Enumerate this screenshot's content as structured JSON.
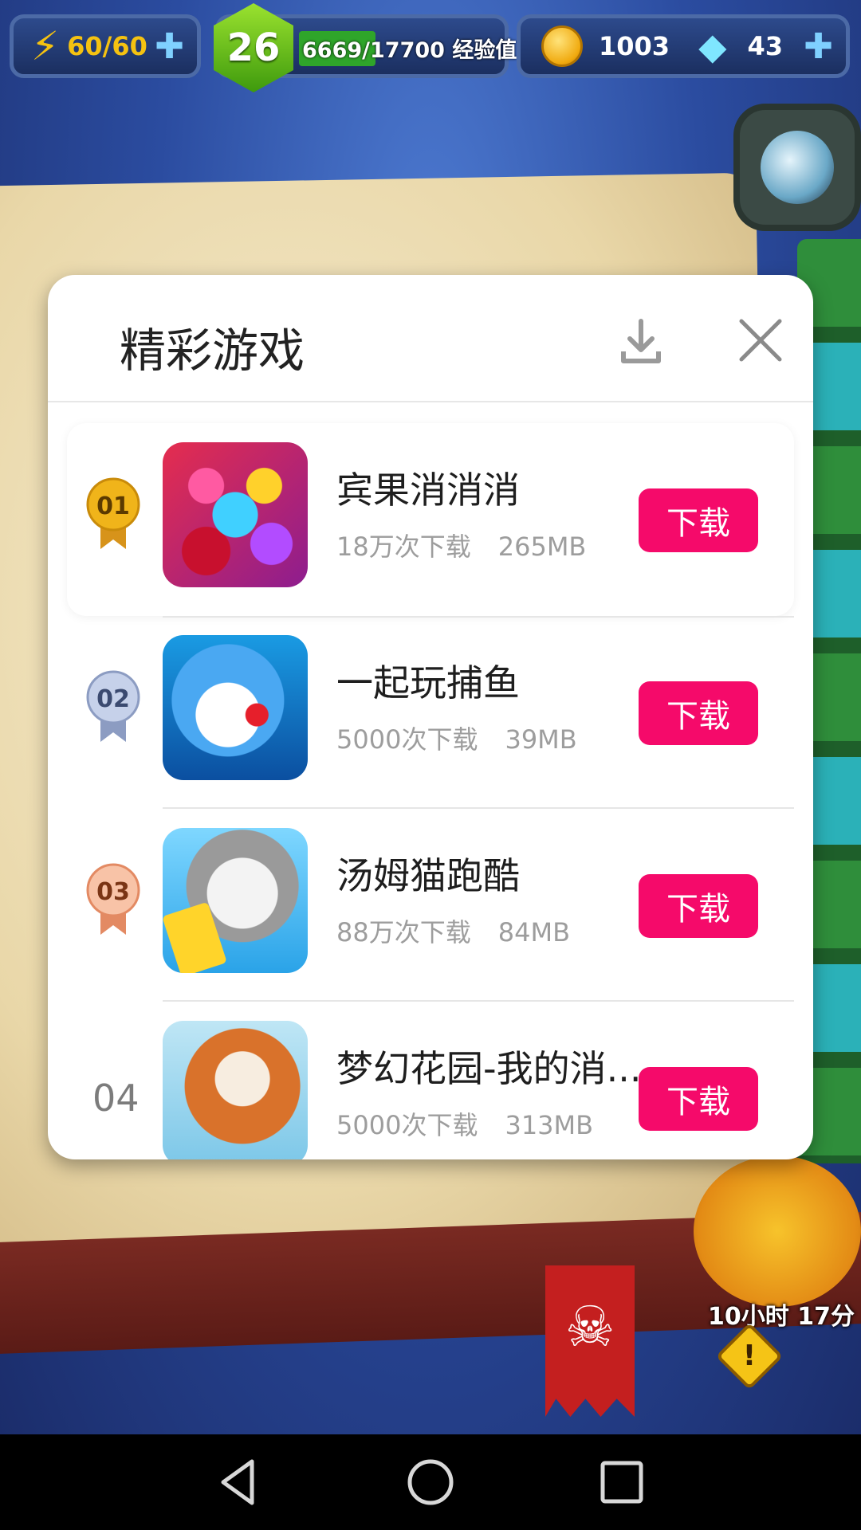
{
  "hud": {
    "energy": "60/60",
    "level": "26",
    "xp": "6669/17700",
    "xp_label": "经验值",
    "xp_progress": 0.377,
    "coins": "1003",
    "gems": "43"
  },
  "game": {
    "boss_timer": "10小时 17分",
    "warning_mark": "!"
  },
  "modal": {
    "title": "精彩游戏",
    "download_label": "下载",
    "games": [
      {
        "rank": "01",
        "name": "宾果消消消",
        "downloads": "18万次下载",
        "size": "265MB"
      },
      {
        "rank": "02",
        "name": "一起玩捕鱼",
        "downloads": "5000次下载",
        "size": "39MB"
      },
      {
        "rank": "03",
        "name": "汤姆猫跑酷",
        "downloads": "88万次下载",
        "size": "84MB"
      },
      {
        "rank": "04",
        "name": "梦幻花园-我的消...",
        "downloads": "5000次下载",
        "size": "313MB"
      }
    ]
  },
  "colors": {
    "accent": "#f50a6a",
    "gold_medal": "#f0b41a",
    "silver_medal": "#aab8d6",
    "bronze_medal": "#f2a784"
  }
}
